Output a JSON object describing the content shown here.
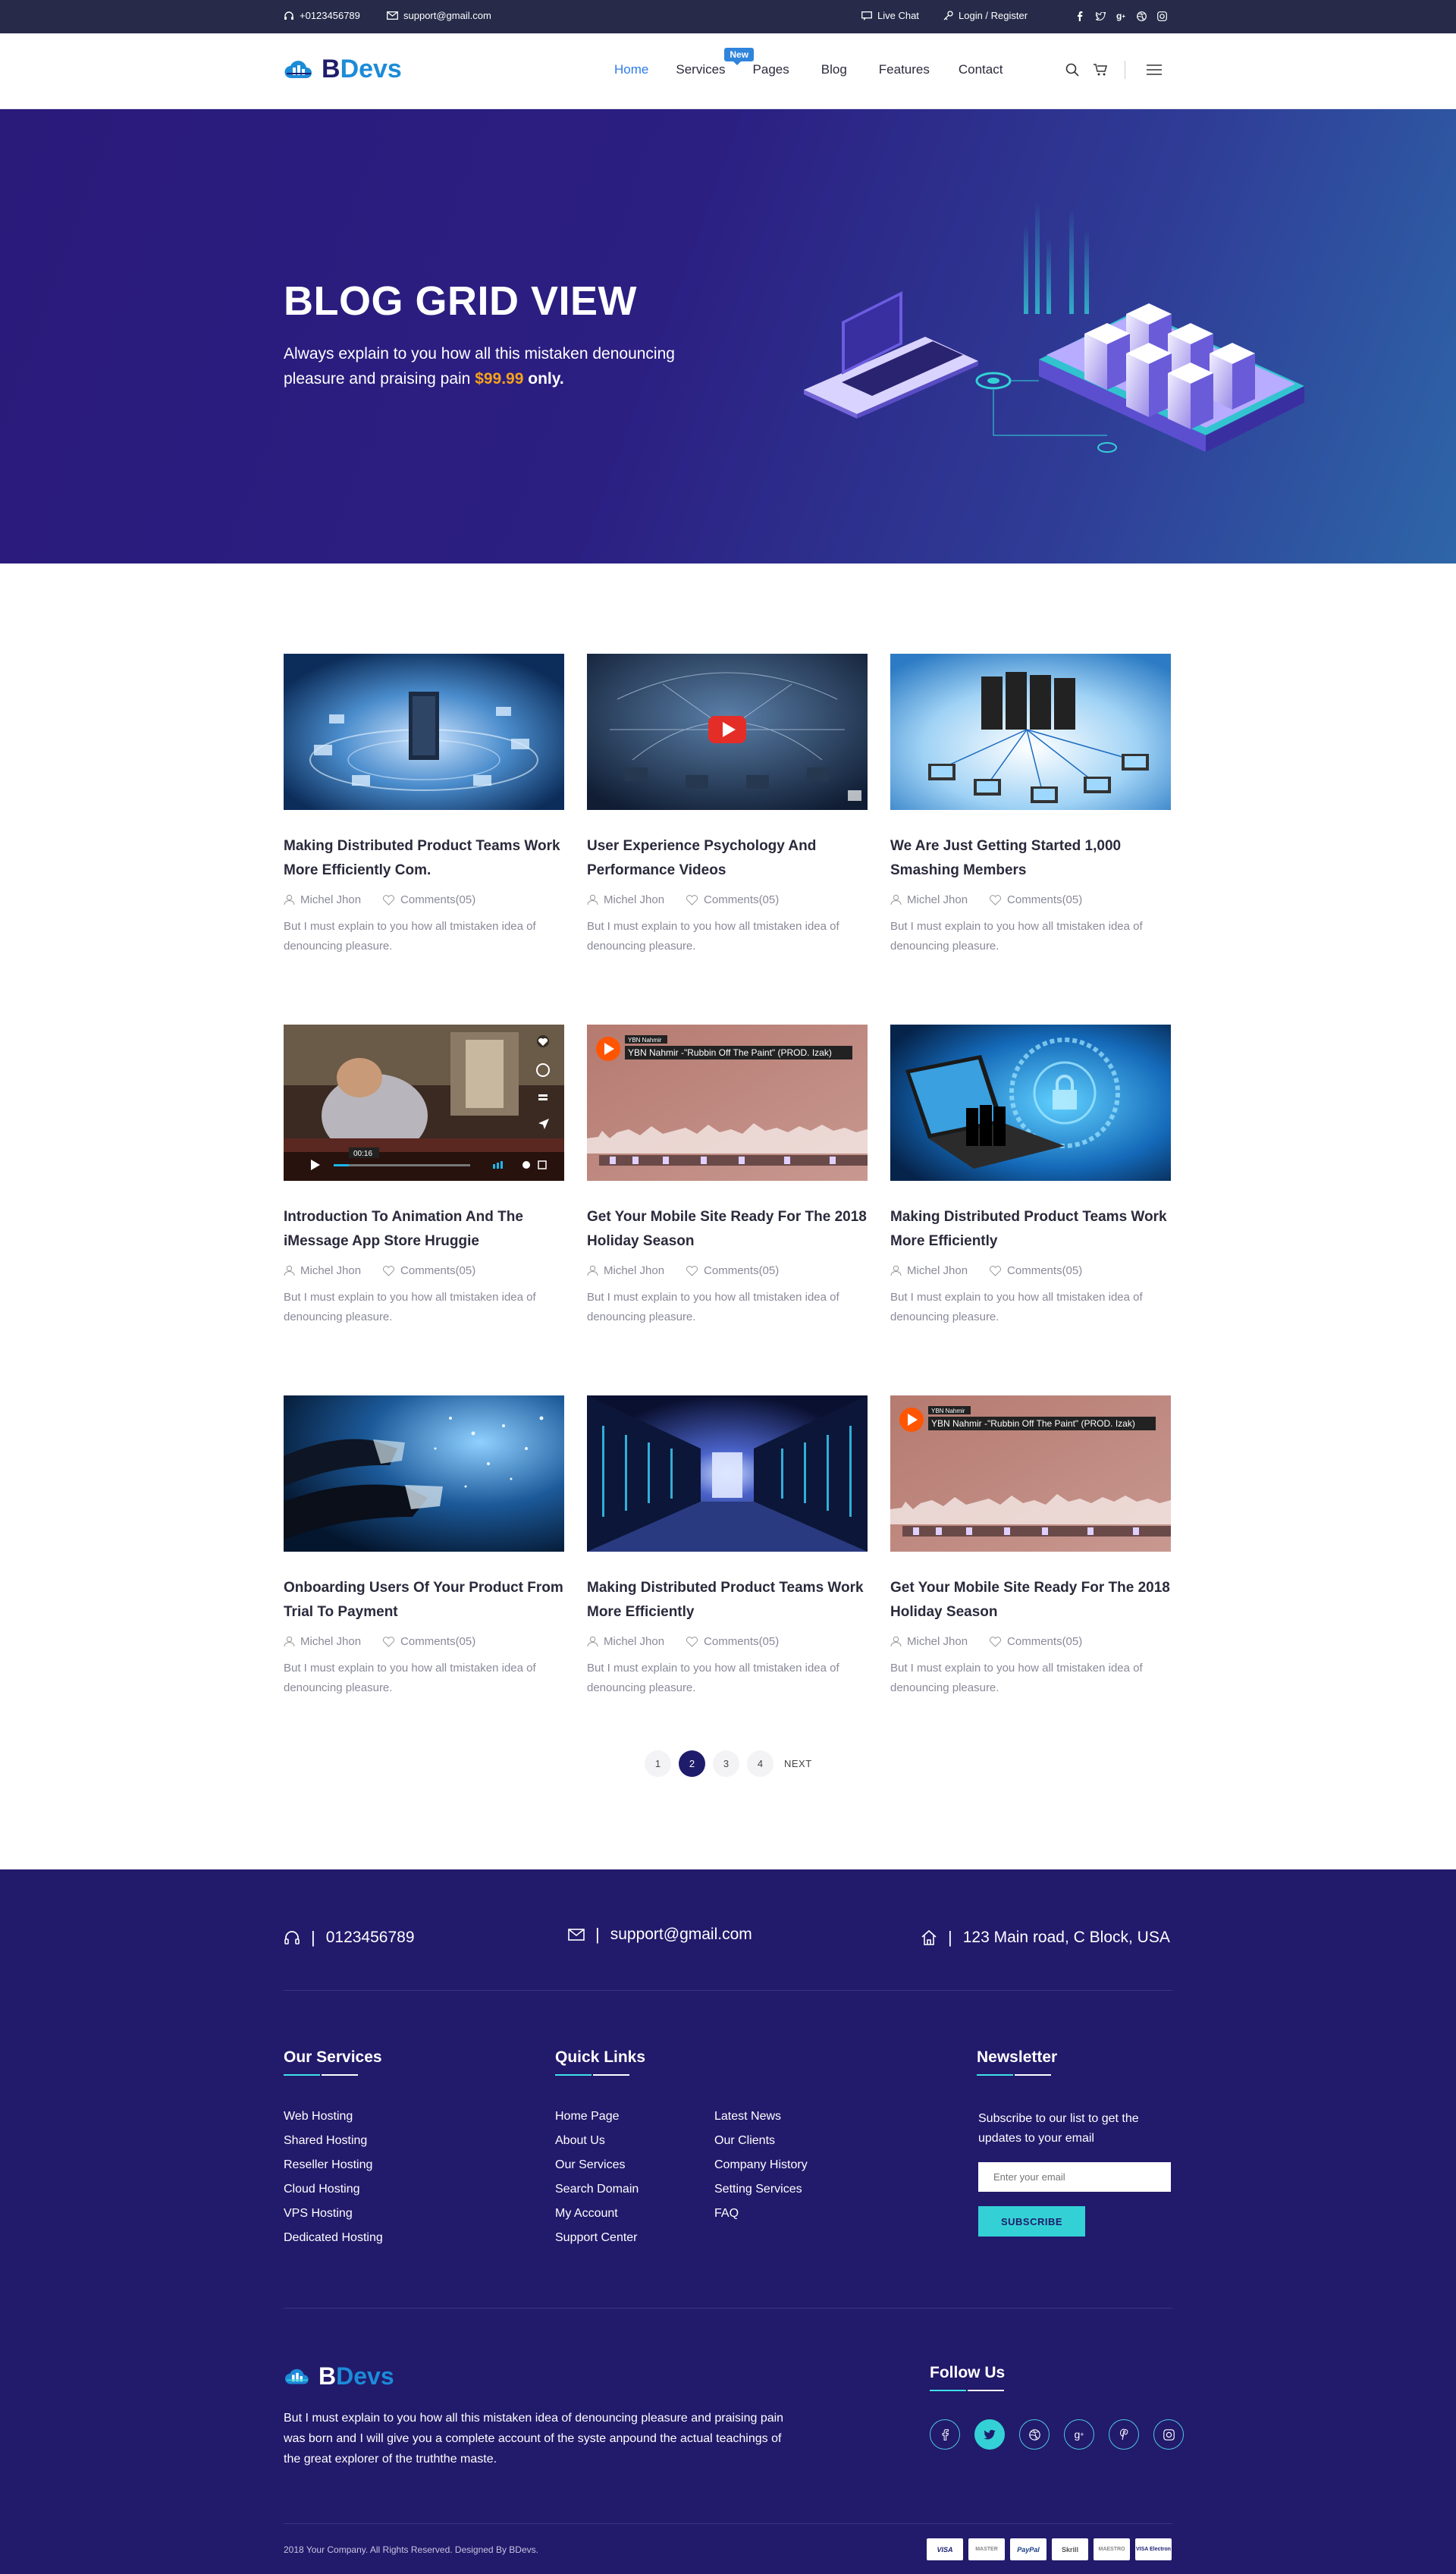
{
  "topbar": {
    "phone": "+0123456789",
    "email": "support@gmail.com",
    "live_chat": "Live Chat",
    "login": "Login / Register",
    "socials": [
      "facebook-icon",
      "twitter-icon",
      "google-plus-icon",
      "dribbble-icon",
      "instagram-icon"
    ]
  },
  "header": {
    "logo_b": "B",
    "logo_rest": "Devs",
    "nav": [
      "Home",
      "Services",
      "Pages",
      "Blog",
      "Features",
      "Contact"
    ],
    "new_badge": "New"
  },
  "hero": {
    "title": "BLOG GRID VIEW",
    "text": "Always explain to you how all this mistaken denouncing pleasure and praising pain",
    "price": "$99.99",
    "only": "only."
  },
  "posts": [
    {
      "title": "Making Distributed Product Teams Work More Efficiently Com.",
      "author": "Michel Jhon",
      "comments": "Comments(05)",
      "excerpt": "But I must explain to you how all tmistaken idea of denouncing pleasure.",
      "image": "network-server-image"
    },
    {
      "title": "User Experience Psychology And Performance Videos",
      "author": "Michel Jhon",
      "comments": "Comments(05)",
      "excerpt": "But I must explain to you how all tmistaken idea of denouncing pleasure.",
      "image": "youtube-video-image"
    },
    {
      "title": "We Are Just Getting Started 1,000 Smashing Members",
      "author": "Michel Jhon",
      "comments": "Comments(05)",
      "excerpt": "But I must explain to you how all tmistaken idea of denouncing pleasure.",
      "image": "server-laptops-image"
    },
    {
      "title": "Introduction To Animation And The iMessage App Store Hruggie",
      "author": "Michel Jhon",
      "comments": "Comments(05)",
      "excerpt": "But I must explain to you how all tmistaken idea of denouncing pleasure.",
      "image": "vimeo-video-image"
    },
    {
      "title": "Get Your Mobile Site Ready For The 2018 Holiday Season",
      "author": "Michel Jhon",
      "comments": "Comments(05)",
      "excerpt": "But I must explain to you how all tmistaken idea of denouncing pleasure.",
      "image": "soundcloud-player-image"
    },
    {
      "title": "Making Distributed Product Teams Work More Efficiently",
      "author": "Michel Jhon",
      "comments": "Comments(05)",
      "excerpt": "But I must explain to you how all tmistaken idea of denouncing pleasure.",
      "image": "security-laptop-image"
    },
    {
      "title": "Onboarding Users Of Your Product From Trial To Payment",
      "author": "Michel Jhon",
      "comments": "Comments(05)",
      "excerpt": "But I must explain to you how all tmistaken idea of denouncing pleasure.",
      "image": "ethernet-cables-image"
    },
    {
      "title": "Making Distributed Product Teams Work More Efficiently",
      "author": "Michel Jhon",
      "comments": "Comments(05)",
      "excerpt": "But I must explain to you how all tmistaken idea of denouncing pleasure.",
      "image": "datacenter-image"
    },
    {
      "title": "Get Your Mobile Site Ready For The 2018 Holiday Season",
      "author": "Michel Jhon",
      "comments": "Comments(05)",
      "excerpt": "But I must explain to you how all tmistaken idea of denouncing pleasure.",
      "image": "soundcloud-player-image"
    }
  ],
  "media": {
    "sc_user": "YBN Nahmir",
    "sc_track": "YBN Nahmir -\"Rubbin Off The Paint\" (PROD. Izak)",
    "video_time": "00:16"
  },
  "pagination": {
    "pages": [
      "1",
      "2",
      "3",
      "4"
    ],
    "current": "2",
    "next": "NEXT"
  },
  "footer": {
    "phone": "0123456789",
    "email": "support@gmail.com",
    "address": "123 Main road, C Block, USA",
    "services_title": "Our Services",
    "services": [
      "Web Hosting",
      "Shared Hosting",
      "Reseller Hosting",
      "Cloud Hosting",
      "VPS Hosting",
      "Dedicated Hosting"
    ],
    "links_title": "Quick Links",
    "links_col1": [
      "Home Page",
      "About Us",
      "Our Services",
      "Search Domain",
      "My Account",
      "Support Center"
    ],
    "links_col2": [
      "Latest News",
      "Our Clients",
      "Company History",
      "Setting Services",
      "FAQ"
    ],
    "newsletter_title": "Newsletter",
    "newsletter_text": "Subscribe to our list to get the updates to your email",
    "email_placeholder": "Enter your email",
    "subscribe": "SUBSCRIBE",
    "about": "But I must explain to you how all this mistaken idea of denouncing pleasure and praising pain was born and I will give you a complete account of the syste anpound the actual teachings of the great explorer of the truththe maste.",
    "follow_title": "Follow Us",
    "follow_icons": [
      "facebook-icon",
      "twitter-icon",
      "dribbble-icon",
      "google-plus-icon",
      "pinterest-icon",
      "instagram-icon"
    ],
    "copyright": "2018 Your Company. All Rights Reserved. Designed By BDevs.",
    "payments": [
      "VISA",
      "MASTER",
      "PayPal",
      "Skrill",
      "MAESTRO",
      "VISA Electron"
    ]
  },
  "colors": {
    "navy": "#221a6b",
    "accent": "#33d1d6",
    "orange": "#f6a21a",
    "link": "#2e7ce5"
  }
}
